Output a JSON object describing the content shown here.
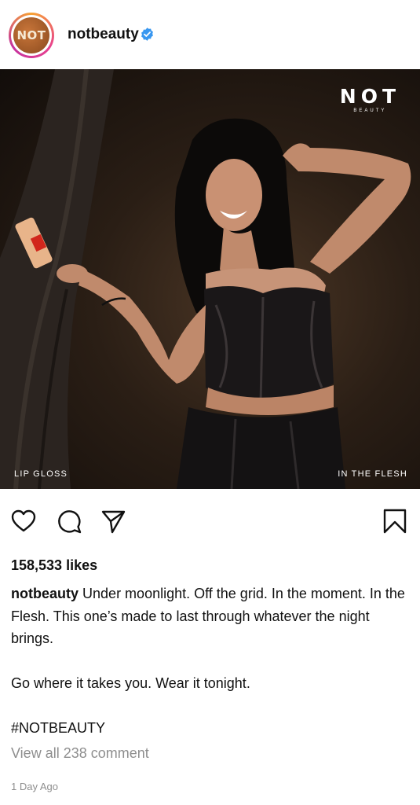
{
  "header": {
    "avatar_text": "NOT",
    "username": "notbeauty",
    "verified_icon": "verified-badge-icon"
  },
  "photo": {
    "brand_main": "NOT",
    "brand_sub": "BEAUTY",
    "label_left": "LIP GLOSS",
    "label_right": "IN THE FLESH"
  },
  "actions": {
    "like_icon": "heart-icon",
    "comment_icon": "comment-icon",
    "share_icon": "send-icon",
    "save_icon": "bookmark-icon"
  },
  "post": {
    "likes": "158,533 likes",
    "caption_user": "notbeauty",
    "caption_line1": "Under moonlight. Off the grid. In the moment. In the Flesh. This one’s made to last through whatever the night brings.",
    "caption_line2": "Go where it takes you. Wear it tonight.",
    "caption_line3": "#NOTBEAUTY",
    "comments_link": "View all 238 comment",
    "timestamp": "1 Day Ago"
  },
  "colors": {
    "link_gray": "#8e8e8e",
    "verified_blue": "#3897f0"
  }
}
